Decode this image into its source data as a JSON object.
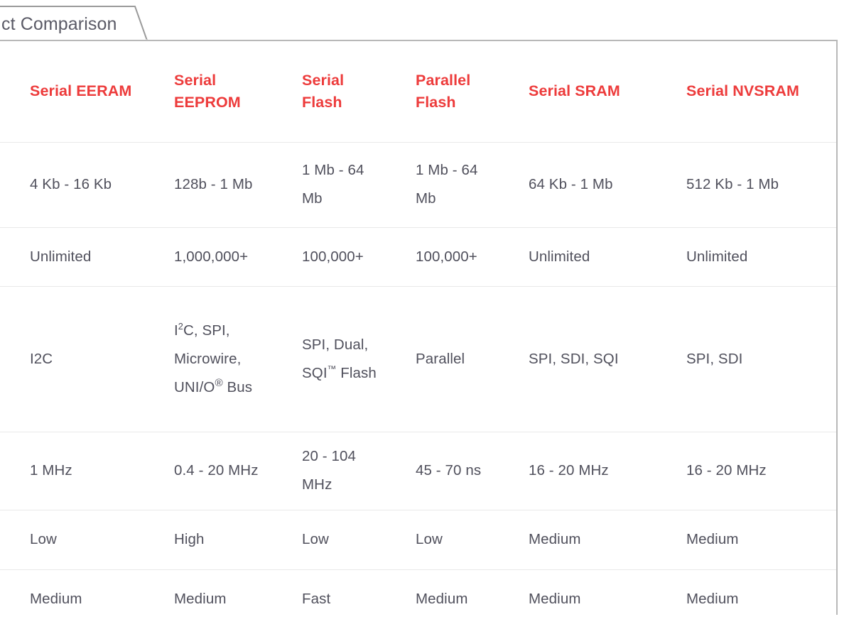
{
  "tab": {
    "label": "ct Comparison",
    "full_label_visible": "ct Comparison"
  },
  "colors": {
    "header_text": "#ed3b3b",
    "body_text": "#50505c",
    "row_divider": "#e9e9e9",
    "panel_border": "#b8b8b8",
    "tab_border": "#9a9a9a",
    "background": "#ffffff"
  },
  "table": {
    "headers": [
      "Serial EERAM",
      "Serial EEPROM",
      "Serial Flash",
      "Parallel Flash",
      "Serial SRAM",
      "Serial NVSRAM"
    ],
    "rows": [
      {
        "key": "density",
        "cells": [
          "4 Kb - 16 Kb",
          "128b - 1 Mb",
          "1 Mb - 64 Mb",
          "1 Mb - 64 Mb",
          "64 Kb - 1 Mb",
          "512 Kb - 1 Mb"
        ]
      },
      {
        "key": "endurance",
        "cells": [
          "Unlimited",
          "1,000,000+",
          "100,000+",
          "100,000+",
          "Unlimited",
          "Unlimited"
        ]
      },
      {
        "key": "interface",
        "cells": [
          "I2C",
          "I²C, SPI, Microwire, UNI/O® Bus",
          "SPI, Dual, SQI™ Flash",
          "Parallel",
          "SPI, SDI, SQI",
          "SPI, SDI"
        ]
      },
      {
        "key": "speed",
        "cells": [
          "1 MHz",
          "0.4 - 20 MHz",
          "20 - 104 MHz",
          "45 - 70 ns",
          "16 - 20 MHz",
          "16 - 20 MHz"
        ]
      },
      {
        "key": "power",
        "cells": [
          "Low",
          "High",
          "Low",
          "Low",
          "Medium",
          "Medium"
        ]
      },
      {
        "key": "access",
        "cells": [
          "Medium",
          "Medium",
          "Fast",
          "Medium",
          "Medium",
          "Medium"
        ]
      }
    ]
  }
}
